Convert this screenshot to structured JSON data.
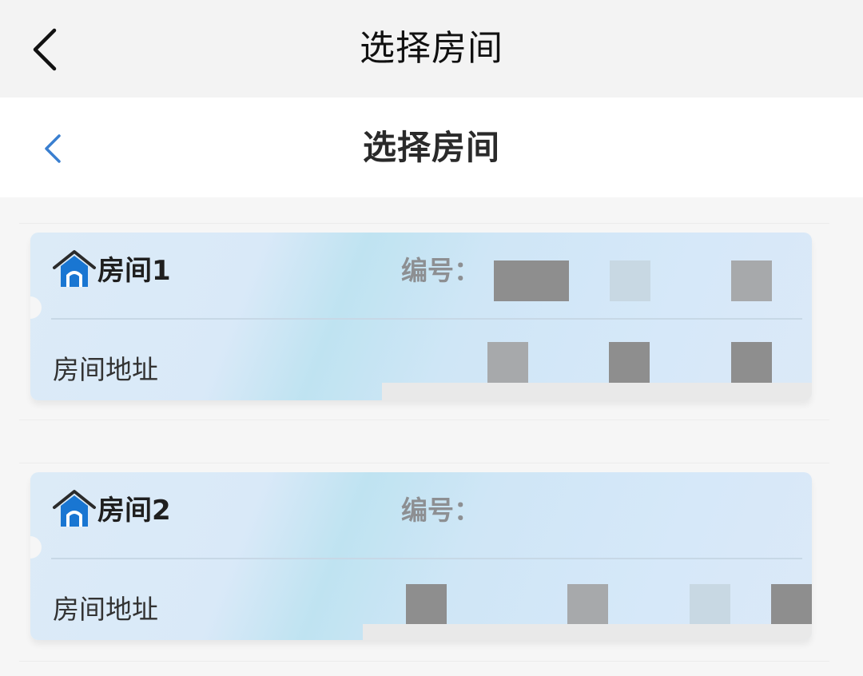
{
  "outer_nav": {
    "title": "选择房间",
    "back_icon": "chevron-left-icon"
  },
  "inner_nav": {
    "title": "选择房间",
    "back_icon": "chevron-left-icon",
    "accent_color": "#3a7fd0"
  },
  "rooms": [
    {
      "name": "房间1",
      "code_label": "编号：",
      "address_label": "房间地址",
      "icon": "house-icon",
      "code_redacted": true,
      "address_redacted": true
    },
    {
      "name": "房间2",
      "code_label": "编号：",
      "address_label": "房间地址",
      "icon": "house-icon",
      "code_redacted": false,
      "address_redacted": true
    }
  ],
  "colors": {
    "card_bg": "#d9e9f8",
    "icon_blue": "#1976d2",
    "icon_roof": "#2b2b2b"
  }
}
